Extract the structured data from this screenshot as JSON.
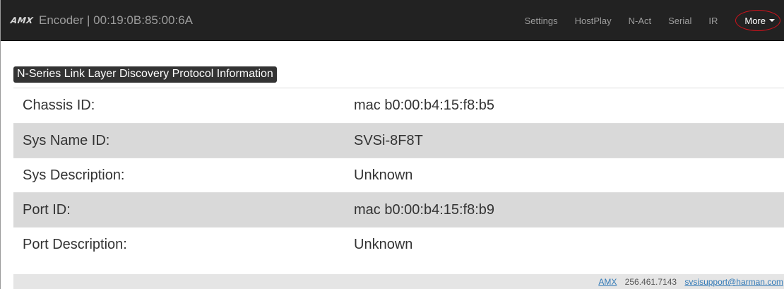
{
  "navbar": {
    "logo_text": "AMX",
    "title": "Encoder | 00:19:0B:85:00:6A",
    "items": [
      {
        "label": "Settings"
      },
      {
        "label": "HostPlay"
      },
      {
        "label": "N-Act"
      },
      {
        "label": "Serial"
      },
      {
        "label": "IR"
      }
    ],
    "more_label": "More",
    "more_highlight_color": "#d0121b"
  },
  "section": {
    "title": "N-Series Link Layer Discovery Protocol Information"
  },
  "rows": [
    {
      "key": "Chassis ID:",
      "value": "mac b0:00:b4:15:f8:b5"
    },
    {
      "key": "Sys Name ID:",
      "value": "SVSi-8F8T"
    },
    {
      "key": "Sys Description:",
      "value": "Unknown"
    },
    {
      "key": "Port ID:",
      "value": "mac b0:00:b4:15:f8:b9"
    },
    {
      "key": "Port Description:",
      "value": "Unknown"
    }
  ],
  "footer": {
    "link_amx": "AMX",
    "phone": "256.461.7143",
    "email": "svsisupport@harman.com"
  },
  "colors": {
    "navbar_bg": "#222222",
    "row_shade": "#d9d9d9",
    "link": "#337ab7"
  }
}
